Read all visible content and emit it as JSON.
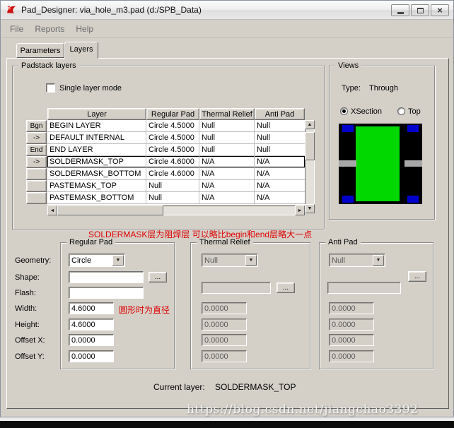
{
  "window": {
    "title": "Pad_Designer: via_hole_m3.pad (d:/SPB_Data)"
  },
  "menu": {
    "items": [
      "File",
      "Reports",
      "Help"
    ]
  },
  "tabs": {
    "parameters": "Parameters",
    "layers": "Layers"
  },
  "icons": {
    "dropdown": "▼",
    "close": "×",
    "scroll_up": "▲",
    "scroll_down": "▼",
    "scroll_left": "◄",
    "scroll_right": "►",
    "ellipsis": "..."
  },
  "padstack": {
    "title": "Padstack layers",
    "single_layer_mode_label": "Single layer mode",
    "columns": [
      "Layer",
      "Regular Pad",
      "Thermal Relief",
      "Anti Pad"
    ],
    "row_buttons": [
      "Bgn",
      "->",
      "End",
      "->",
      "",
      "",
      ""
    ],
    "rows": [
      {
        "layer": "BEGIN LAYER",
        "regular_pad": "Circle 4.5000",
        "thermal_relief": "Null",
        "anti_pad": "Null"
      },
      {
        "layer": "DEFAULT INTERNAL",
        "regular_pad": "Circle 4.5000",
        "thermal_relief": "Null",
        "anti_pad": "Null"
      },
      {
        "layer": "END LAYER",
        "regular_pad": "Circle 4.5000",
        "thermal_relief": "Null",
        "anti_pad": "Null"
      },
      {
        "layer": "SOLDERMASK_TOP",
        "regular_pad": "Circle 4.6000",
        "thermal_relief": "N/A",
        "anti_pad": "N/A"
      },
      {
        "layer": "SOLDERMASK_BOTTOM",
        "regular_pad": "Circle 4.6000",
        "thermal_relief": "N/A",
        "anti_pad": "N/A"
      },
      {
        "layer": "PASTEMASK_TOP",
        "regular_pad": "Null",
        "thermal_relief": "N/A",
        "anti_pad": "N/A"
      },
      {
        "layer": "PASTEMASK_BOTTOM",
        "regular_pad": "Null",
        "thermal_relief": "N/A",
        "anti_pad": "N/A"
      }
    ],
    "annotation": "SOLDERMASK层为阻焊层 可以略比begin和end层略大一点"
  },
  "views": {
    "title": "Views",
    "type_label": "Type:",
    "type_value": "Through",
    "xsection_label": "XSection",
    "top_label": "Top"
  },
  "detail": {
    "labels": [
      "Geometry:",
      "Shape:",
      "Flash:",
      "Width:",
      "Height:",
      "Offset X:",
      "Offset Y:"
    ],
    "regular_pad": {
      "title": "Regular Pad",
      "geometry": "Circle",
      "shape": "",
      "flash": "",
      "width": "4.6000",
      "height": "4.6000",
      "offset_x": "0.0000",
      "offset_y": "0.0000",
      "annotation": "圆形时为直径"
    },
    "thermal_relief": {
      "title": "Thermal Relief",
      "geometry": "Null",
      "flash": "",
      "width": "0.0000",
      "height": "0.0000",
      "offset_x": "0.0000",
      "offset_y": "0.0000"
    },
    "anti_pad": {
      "title": "Anti Pad",
      "geometry": "Null",
      "flash": "",
      "width": "0.0000",
      "height": "0.0000",
      "offset_x": "0.0000",
      "offset_y": "0.0000"
    }
  },
  "footer": {
    "current_layer_label": "Current layer:",
    "current_layer_value": "SOLDERMASK_TOP"
  },
  "watermark": "https://blog.csdn.net/jiangchao3392",
  "colors": {
    "pad_green": "#00d800",
    "pad_blue": "#0000cc",
    "annotation_red": "#dd0000",
    "window_bg": "#d4d0c8"
  }
}
